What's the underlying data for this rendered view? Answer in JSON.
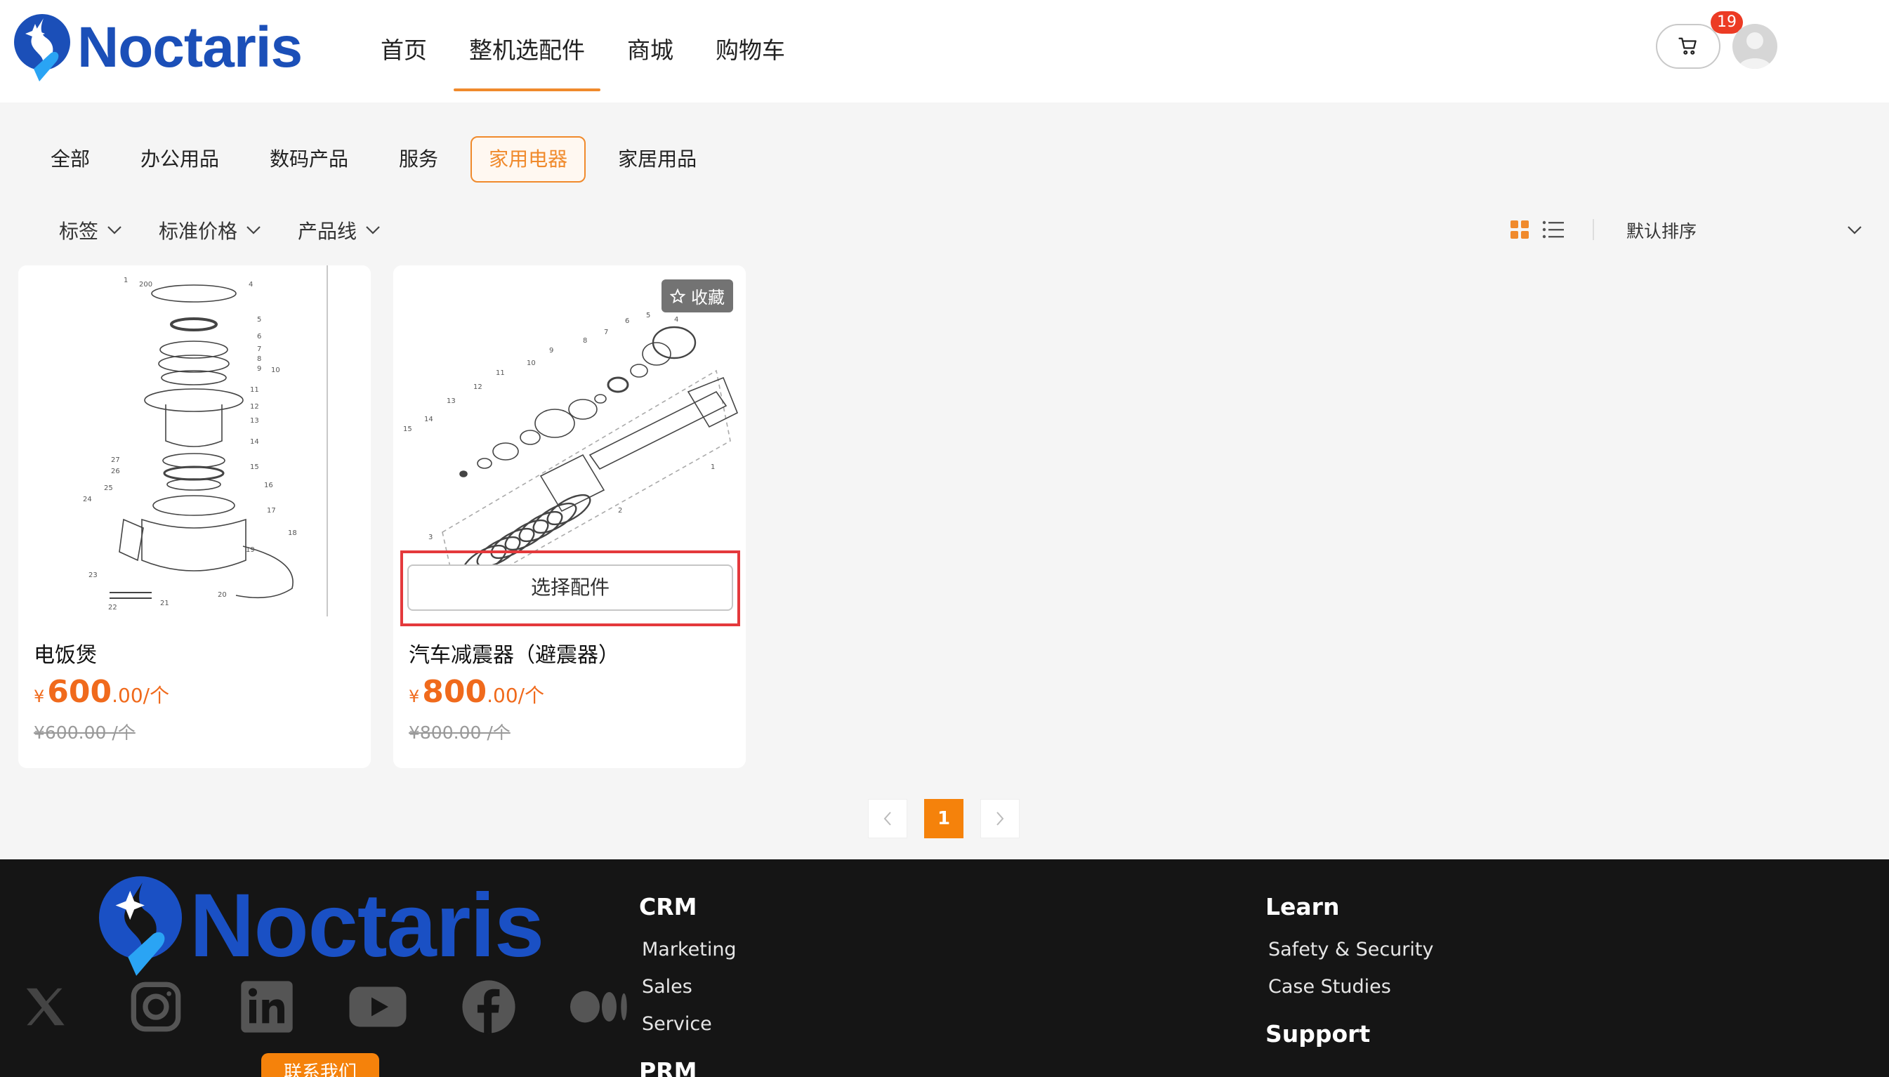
{
  "header": {
    "brand": "Noctaris",
    "nav": [
      "首页",
      "整机选配件",
      "商城",
      "购物车"
    ],
    "active_nav": 1,
    "cart_count": "19"
  },
  "categories": {
    "items": [
      "全部",
      "办公用品",
      "数码产品",
      "服务",
      "家用电器",
      "家居用品"
    ],
    "active": 4
  },
  "filters": [
    "标签",
    "标准价格",
    "产品线"
  ],
  "sort": {
    "label": "默认排序"
  },
  "products": [
    {
      "name": "电饭煲",
      "currency": "¥",
      "price_int": "600",
      "price_dec": ".00/个",
      "old_price": "¥600.00 /个"
    },
    {
      "name": "汽车减震器（避震器）",
      "currency": "¥",
      "price_int": "800",
      "price_dec": ".00/个",
      "old_price": "¥800.00 /个",
      "favorite_label": "收藏",
      "select_label": "选择配件"
    }
  ],
  "pagination": {
    "current": "1"
  },
  "footer": {
    "brand": "Noctaris",
    "contact_label": "联系我们",
    "col1": {
      "title": "CRM",
      "links": [
        "Marketing",
        "Sales",
        "Service"
      ],
      "title2": "PRM"
    },
    "col2": {
      "title": "Learn",
      "links": [
        "Safety & Security",
        "Case Studies"
      ],
      "title2": "Support"
    }
  },
  "colors": {
    "accent": "#f08a2c",
    "brand": "#1b4fb8",
    "badge": "#ec3b24"
  }
}
